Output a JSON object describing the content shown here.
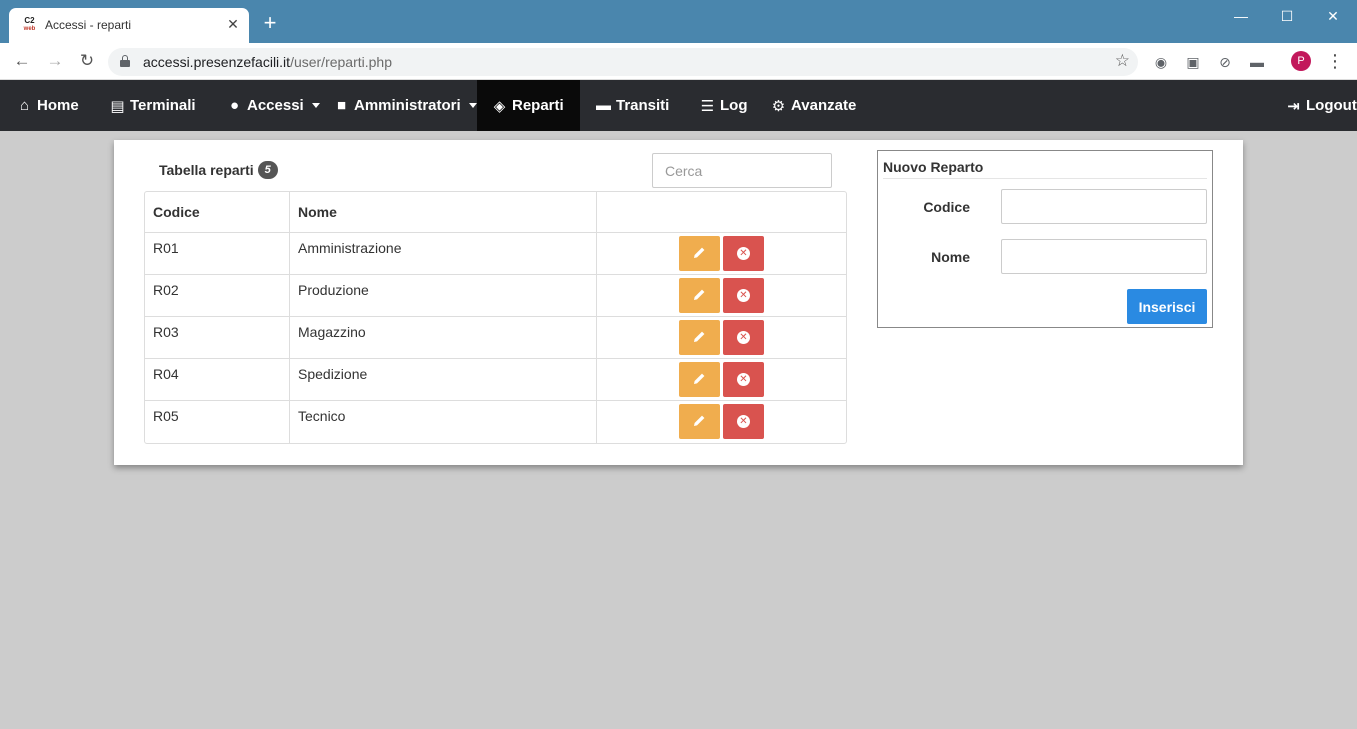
{
  "browser": {
    "tab_title": "Accessi - reparti",
    "favicon_top": "C2",
    "favicon_bottom": "web",
    "url_host": "accessi.presenzefacili.it",
    "url_path": "/user/reparti.php",
    "profile_initial": "P"
  },
  "navbar": {
    "items": [
      {
        "label": "Home",
        "icon": "home-icon"
      },
      {
        "label": "Terminali",
        "icon": "terminal-icon"
      },
      {
        "label": "Accessi",
        "icon": "user-icon",
        "dropdown": true
      },
      {
        "label": "Amministratori",
        "icon": "lock-icon",
        "dropdown": true
      },
      {
        "label": "Reparti",
        "icon": "tags-icon",
        "active": true
      },
      {
        "label": "Transiti",
        "icon": "card-icon"
      },
      {
        "label": "Log",
        "icon": "list-icon"
      },
      {
        "label": "Avanzate",
        "icon": "gear-icon"
      }
    ],
    "logout": {
      "label": "Logout",
      "icon": "logout-icon"
    }
  },
  "table": {
    "title": "Tabella reparti",
    "count": "5",
    "search_placeholder": "Cerca",
    "headers": [
      "Codice",
      "Nome",
      ""
    ],
    "rows": [
      {
        "codice": "R01",
        "nome": "Amministrazione"
      },
      {
        "codice": "R02",
        "nome": "Produzione"
      },
      {
        "codice": "R03",
        "nome": "Magazzino"
      },
      {
        "codice": "R04",
        "nome": "Spedizione"
      },
      {
        "codice": "R05",
        "nome": "Tecnico"
      }
    ]
  },
  "form": {
    "legend": "Nuovo Reparto",
    "codice_label": "Codice",
    "nome_label": "Nome",
    "submit_label": "Inserisci"
  },
  "colors": {
    "navbar_bg": "#2a2c30",
    "edit_button": "#f0ad4e",
    "delete_button": "#d9534f",
    "primary": "#2a8ae2"
  }
}
